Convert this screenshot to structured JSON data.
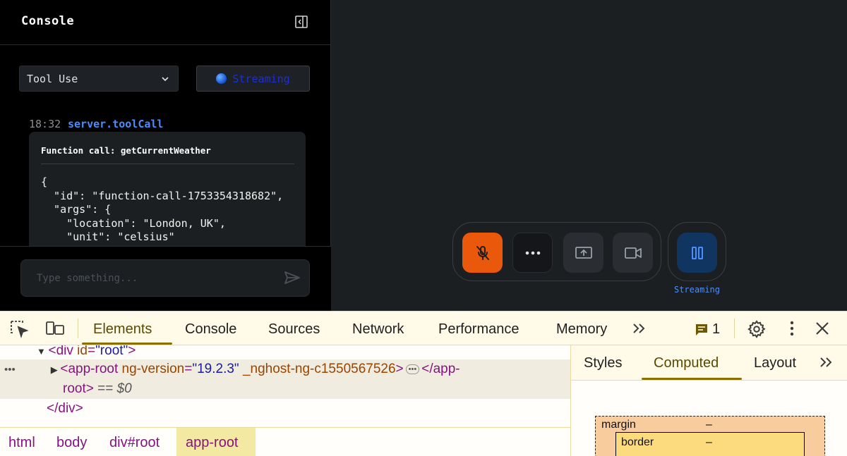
{
  "console": {
    "title": "Console",
    "filter_selected": "Tool Use",
    "streaming_label": "Streaming",
    "log": {
      "time": "18:32",
      "source": "server.toolCall",
      "card_title": "Function call: getCurrentWeather",
      "code": "{\n  \"id\": \"function-call-1753354318682\",\n  \"args\": {\n    \"location\": \"London, UK\",\n    \"unit\": \"celsius\"\n  }"
    },
    "input_placeholder": "Type something..."
  },
  "controls": {
    "streaming_label": "Streaming"
  },
  "devtools": {
    "tabs": [
      "Elements",
      "Console",
      "Sources",
      "Network",
      "Performance",
      "Memory"
    ],
    "issues_count": "1",
    "dom": {
      "line1_tag_open": "<div ",
      "line1_attr": "id",
      "line1_val": "\"root\"",
      "line1_tag_close": ">",
      "line2_tag": "<app-root ",
      "line2_attr1": "ng-version",
      "line2_val1": "\"19.2.3\"",
      "line2_attr2": "_nghost-ng-c1550567526",
      "line2_close": "</app-",
      "line3_text": "root>",
      "line3_eq": " == ",
      "line3_ref": "$0",
      "line4_text": "</div>"
    },
    "breadcrumbs": [
      "html",
      "body",
      "div#root",
      "app-root"
    ],
    "side_tabs": [
      "Styles",
      "Computed",
      "Layout"
    ],
    "box_model": {
      "margin_label": "margin",
      "margin_value": "–",
      "border_label": "border",
      "border_value": "–"
    }
  },
  "colors": {
    "accent_blue": "#4c8dfa",
    "mic_orange": "#ea580c",
    "devtools_highlight": "#f3e9a2"
  }
}
